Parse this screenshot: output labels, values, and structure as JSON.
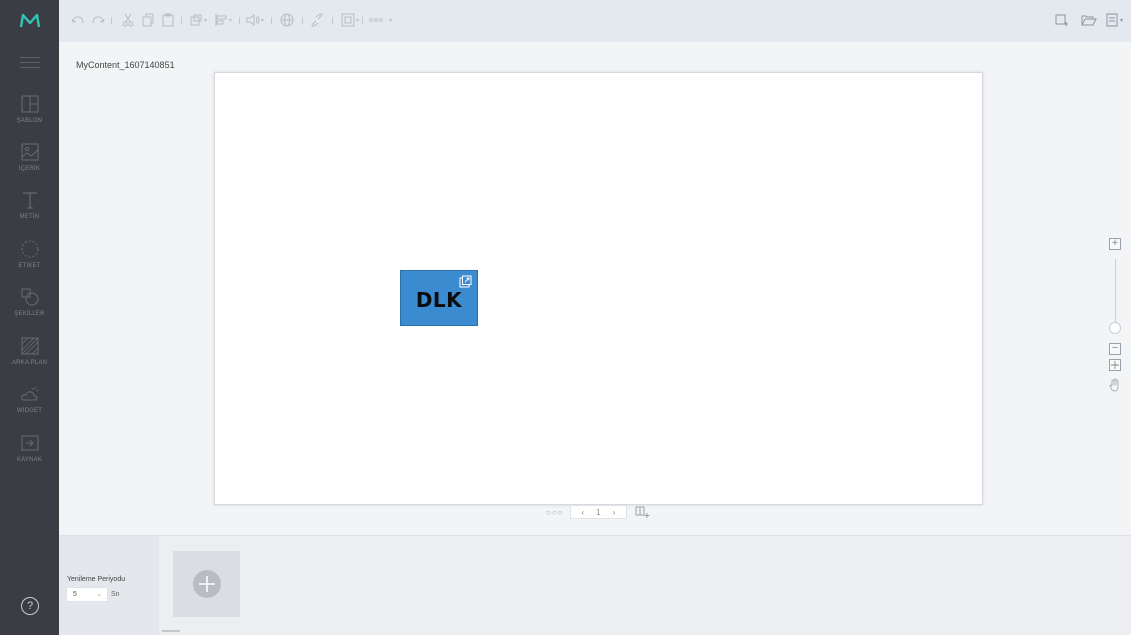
{
  "app": {
    "logo": "M",
    "brand_color": "#2ec4b6"
  },
  "sidebar": {
    "menu_icon": "hamburger-icon",
    "items": [
      {
        "label": "ŞABLON",
        "icon": "template-icon"
      },
      {
        "label": "İÇERİK",
        "icon": "image-icon"
      },
      {
        "label": "METİN",
        "icon": "text-icon"
      },
      {
        "label": "ETİKET",
        "icon": "tag-icon"
      },
      {
        "label": "ŞEKİLLER",
        "icon": "shapes-icon"
      },
      {
        "label": "ARKA PLAN",
        "icon": "background-icon"
      },
      {
        "label": "WIDGET",
        "icon": "weather-icon"
      },
      {
        "label": "KAYNAK",
        "icon": "source-icon"
      }
    ],
    "help_label": "?"
  },
  "toolbar": {
    "left_icons": [
      "undo-icon",
      "redo-icon",
      "cut-icon",
      "copy-icon",
      "paste-icon",
      "arrange-icon",
      "align-icon",
      "audio-icon",
      "web-icon",
      "link-icon",
      "image-icon",
      "more-icon"
    ],
    "right_icons": [
      "new-page-icon",
      "open-folder-icon",
      "save-icon"
    ]
  },
  "workspace": {
    "content_name": "MyContent_1607140851",
    "widget": {
      "text": "DLK",
      "color": "#3a8bd0",
      "badge_icon": "external-link-icon"
    },
    "pager": {
      "dots": "○○○",
      "prev": "‹",
      "page": "1",
      "next": "›",
      "add_icon": "add-page-icon"
    },
    "zoom": {
      "plus": "+",
      "minus": "−",
      "level": 0.02
    }
  },
  "bottom_panel": {
    "refresh_label": "Yenileme Periyodu",
    "refresh_value": "5",
    "refresh_unit": "Sn",
    "add_icon": "add-slide-icon"
  }
}
